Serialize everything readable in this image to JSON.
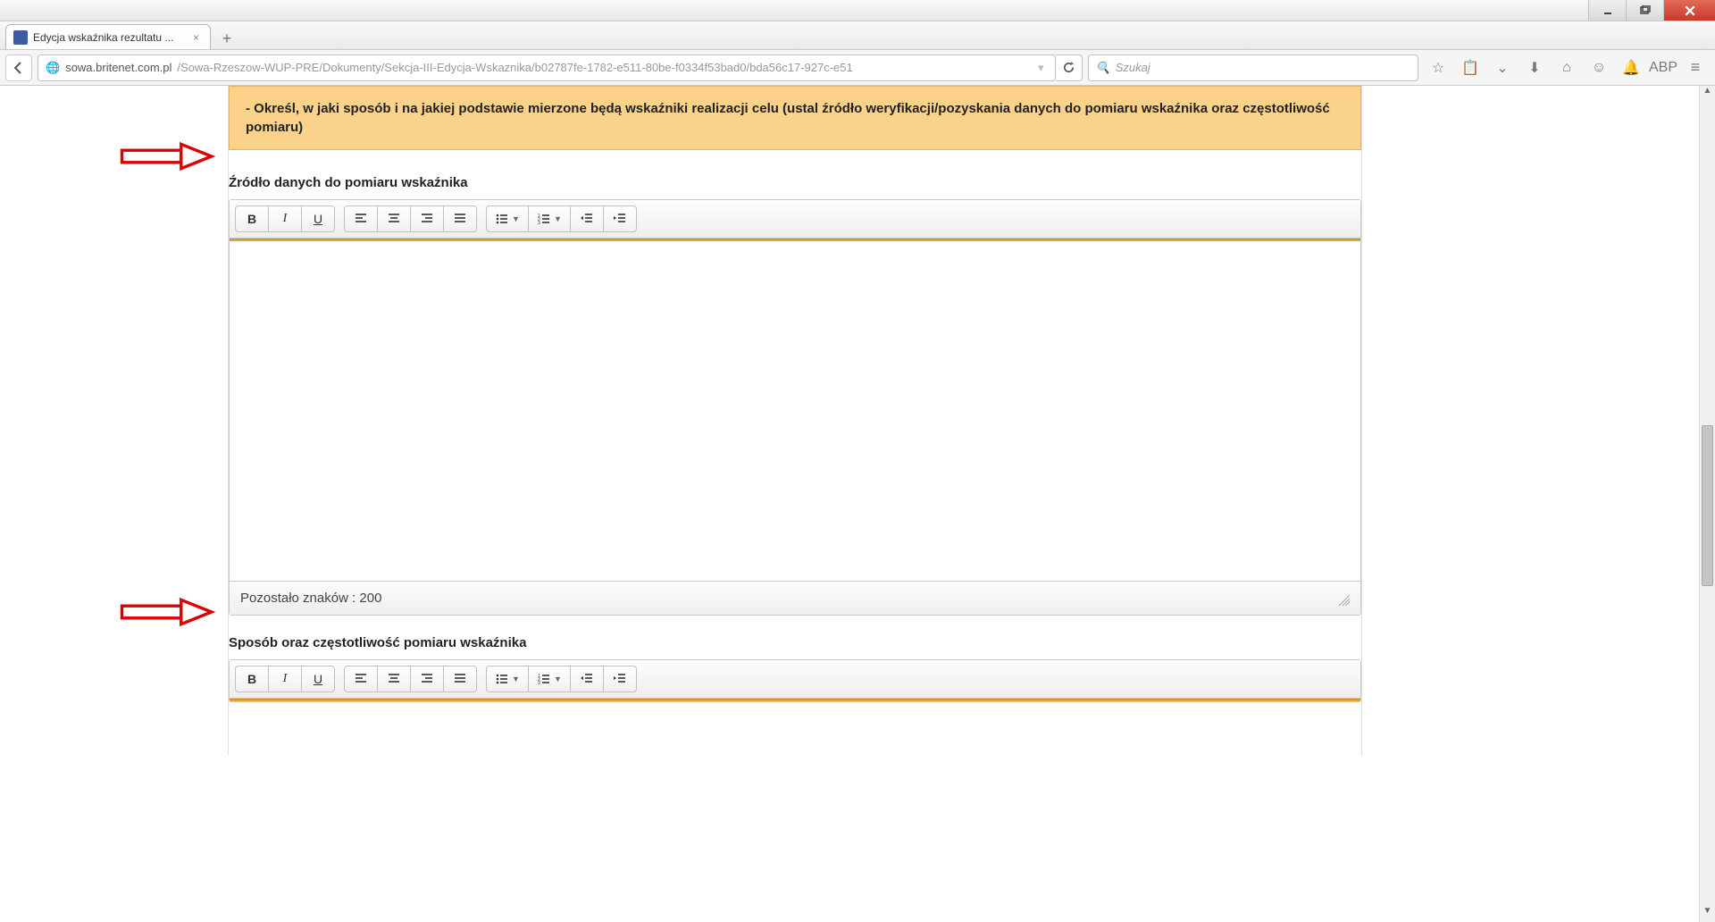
{
  "window": {
    "tab_title": "Edycja wskaźnika rezultatu ..."
  },
  "nav": {
    "url_domain": "sowa.britenet.com.pl",
    "url_path": "/Sowa-Rzeszow-WUP-PRE/Dokumenty/Sekcja-III-Edycja-Wskaznika/b02787fe-1782-e511-80be-f0334f53bad0/bda56c17-927c-e51",
    "search_placeholder": "Szukaj"
  },
  "toolbar_icons": {
    "bookmark": "star-icon",
    "reading_list": "clipboard-icon",
    "pocket": "pocket-icon",
    "downloads": "download-icon",
    "home": "home-icon",
    "chat": "chat-icon",
    "notifications": "bell-icon",
    "abp": "ABP",
    "menu": "hamburger-icon"
  },
  "page": {
    "banner_text": "- Określ, w jaki sposób i na jakiej podstawie mierzone będą wskaźniki realizacji celu (ustal źródło weryfikacji/pozyskania danych do pomiaru wskaźnika oraz częstotliwość pomiaru)",
    "field1_label": "Źródło danych do pomiaru wskaźnika",
    "field2_label": "Sposób oraz częstotliwość pomiaru wskaźnika",
    "char_counter_prefix": "Pozostało znaków : ",
    "char_counter_value": "200"
  },
  "editor_buttons": {
    "bold": "B",
    "italic": "I",
    "underline": "U"
  }
}
